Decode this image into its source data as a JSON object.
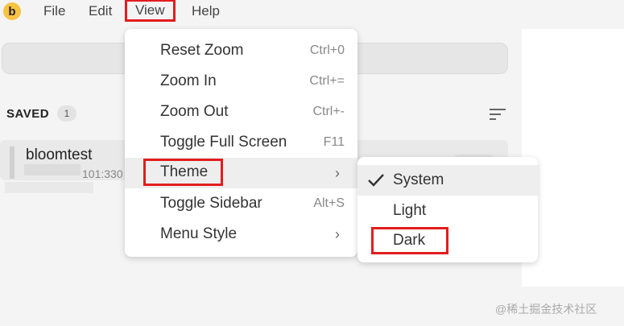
{
  "menubar": {
    "logo_letter": "b",
    "items": [
      "File",
      "Edit",
      "View",
      "Help"
    ]
  },
  "sidebar": {
    "saved_label": "SAVED",
    "saved_count": "1",
    "connection": {
      "name": "bloomtest",
      "subtitle": "101:330"
    }
  },
  "view_menu": {
    "items": [
      {
        "label": "Reset Zoom",
        "shortcut": "Ctrl+0"
      },
      {
        "label": "Zoom In",
        "shortcut": "Ctrl+="
      },
      {
        "label": "Zoom Out",
        "shortcut": "Ctrl+-"
      },
      {
        "label": "Toggle Full Screen",
        "shortcut": "F11"
      },
      {
        "label": "Theme",
        "shortcut": "›"
      },
      {
        "label": "Toggle Sidebar",
        "shortcut": "Alt+S"
      },
      {
        "label": "Menu Style",
        "shortcut": "›"
      }
    ]
  },
  "theme_menu": {
    "items": [
      {
        "label": "System",
        "checked": true
      },
      {
        "label": "Light",
        "checked": false
      },
      {
        "label": "Dark",
        "checked": false
      }
    ]
  },
  "watermark": "@稀土掘金技术社区",
  "colors": {
    "highlight": "#e21d1d",
    "logo": "#f6c343"
  }
}
